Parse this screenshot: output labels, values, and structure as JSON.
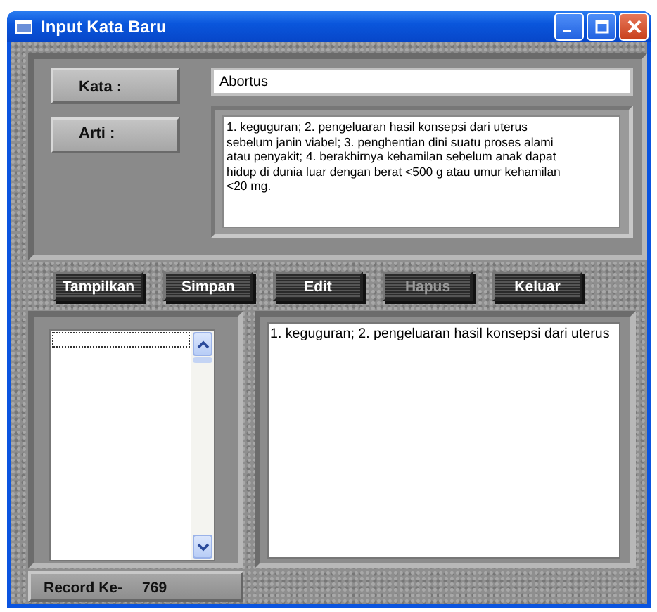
{
  "window": {
    "title": "Input Kata Baru"
  },
  "fields": [
    {
      "label": "Kata  :",
      "value": "Abortus"
    },
    {
      "label": "Arti  :",
      "value": "1. keguguran; 2. pengeluaran hasil konsepsi dari uterus sebelum janin viabel; 3. penghentian dini suatu proses alami atau penyakit; 4. berakhirnya kehamilan sebelum anak dapat hidup di dunia luar dengan berat <500 g atau umur kehamilan <20 mg."
    }
  ],
  "buttons": [
    {
      "label": "Tampilkan",
      "disabled": false
    },
    {
      "label": "Simpan",
      "disabled": false
    },
    {
      "label": "Edit",
      "disabled": false
    },
    {
      "label": "Hapus",
      "disabled": true
    },
    {
      "label": "Keluar",
      "disabled": false
    }
  ],
  "result_text": "1. keguguran; 2. pengeluaran hasil konsepsi dari uterus",
  "record": {
    "label": "Record Ke-",
    "value": "769"
  }
}
